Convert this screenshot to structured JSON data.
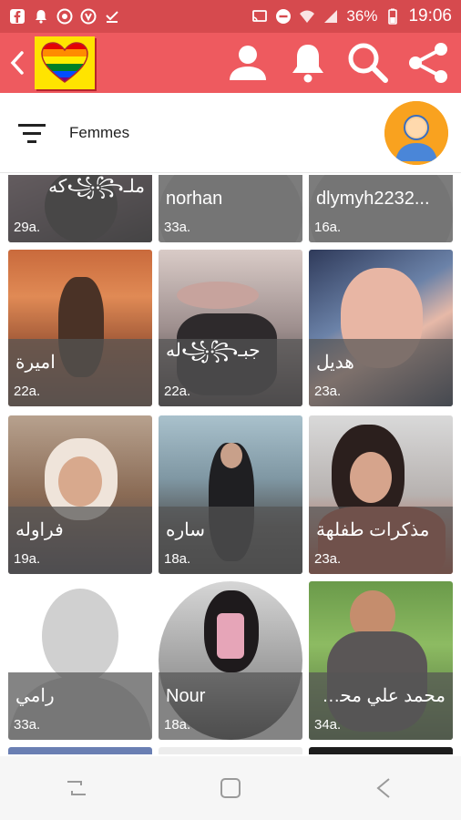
{
  "status_bar": {
    "battery": "36%",
    "time": "19:06",
    "icons": [
      "facebook-icon",
      "notification-icon",
      "chrome-icon",
      "shield-icon",
      "download-done-icon",
      "cast-icon",
      "do-not-disturb-icon",
      "wifi-icon",
      "signal-icon",
      "battery-icon"
    ]
  },
  "app_bar": {
    "colors": {
      "bar": "#ee5a5f",
      "status": "#d64a4e",
      "logo_bg": "#ffe400"
    },
    "icons": [
      "back-icon",
      "pride-heart-logo",
      "profile-icon",
      "bell-icon",
      "search-icon",
      "share-icon"
    ]
  },
  "filter": {
    "label": "Femmes",
    "icons": [
      "filter-icon",
      "user-avatar"
    ]
  },
  "profiles": [
    {
      "name": "ملـ꧁꧂كه",
      "age": "29a."
    },
    {
      "name": "norhan",
      "age": "33a."
    },
    {
      "name": "dlymyh2232...",
      "age": "16a."
    },
    {
      "name": "اميرة",
      "age": "22a."
    },
    {
      "name": "جبـ꧁꧂له",
      "age": "22a."
    },
    {
      "name": "هديل",
      "age": "23a."
    },
    {
      "name": "فراوله",
      "age": "19a."
    },
    {
      "name": "ساره",
      "age": "18a."
    },
    {
      "name": "مذكرات طفلهة",
      "age": "23a."
    },
    {
      "name": "رامي",
      "age": "33a."
    },
    {
      "name": "Nour",
      "age": "18a."
    },
    {
      "name": "محمد علي محمـ...",
      "age": "34a."
    }
  ],
  "nav_bar": {
    "icons": [
      "recents-icon",
      "home-icon",
      "back-nav-icon"
    ]
  }
}
